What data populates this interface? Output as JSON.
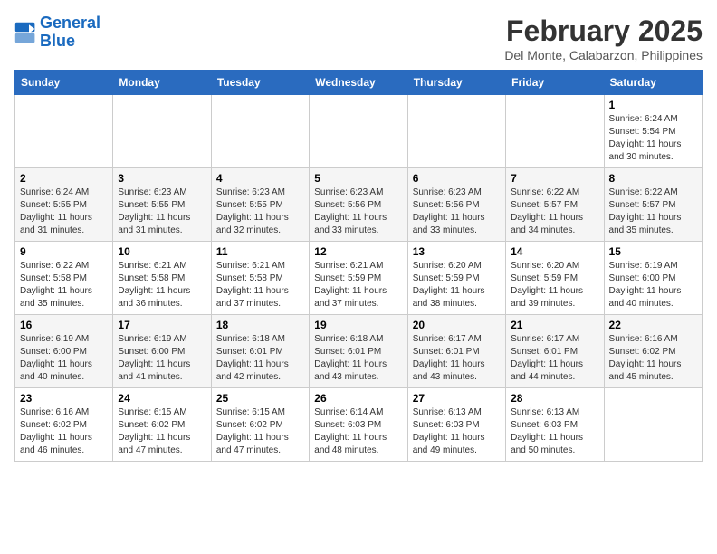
{
  "header": {
    "logo_line1": "General",
    "logo_line2": "Blue",
    "title": "February 2025",
    "subtitle": "Del Monte, Calabarzon, Philippines"
  },
  "days_of_week": [
    "Sunday",
    "Monday",
    "Tuesday",
    "Wednesday",
    "Thursday",
    "Friday",
    "Saturday"
  ],
  "weeks": [
    [
      {
        "day": "",
        "info": ""
      },
      {
        "day": "",
        "info": ""
      },
      {
        "day": "",
        "info": ""
      },
      {
        "day": "",
        "info": ""
      },
      {
        "day": "",
        "info": ""
      },
      {
        "day": "",
        "info": ""
      },
      {
        "day": "1",
        "info": "Sunrise: 6:24 AM\nSunset: 5:54 PM\nDaylight: 11 hours\nand 30 minutes."
      }
    ],
    [
      {
        "day": "2",
        "info": "Sunrise: 6:24 AM\nSunset: 5:55 PM\nDaylight: 11 hours\nand 31 minutes."
      },
      {
        "day": "3",
        "info": "Sunrise: 6:23 AM\nSunset: 5:55 PM\nDaylight: 11 hours\nand 31 minutes."
      },
      {
        "day": "4",
        "info": "Sunrise: 6:23 AM\nSunset: 5:55 PM\nDaylight: 11 hours\nand 32 minutes."
      },
      {
        "day": "5",
        "info": "Sunrise: 6:23 AM\nSunset: 5:56 PM\nDaylight: 11 hours\nand 33 minutes."
      },
      {
        "day": "6",
        "info": "Sunrise: 6:23 AM\nSunset: 5:56 PM\nDaylight: 11 hours\nand 33 minutes."
      },
      {
        "day": "7",
        "info": "Sunrise: 6:22 AM\nSunset: 5:57 PM\nDaylight: 11 hours\nand 34 minutes."
      },
      {
        "day": "8",
        "info": "Sunrise: 6:22 AM\nSunset: 5:57 PM\nDaylight: 11 hours\nand 35 minutes."
      }
    ],
    [
      {
        "day": "9",
        "info": "Sunrise: 6:22 AM\nSunset: 5:58 PM\nDaylight: 11 hours\nand 35 minutes."
      },
      {
        "day": "10",
        "info": "Sunrise: 6:21 AM\nSunset: 5:58 PM\nDaylight: 11 hours\nand 36 minutes."
      },
      {
        "day": "11",
        "info": "Sunrise: 6:21 AM\nSunset: 5:58 PM\nDaylight: 11 hours\nand 37 minutes."
      },
      {
        "day": "12",
        "info": "Sunrise: 6:21 AM\nSunset: 5:59 PM\nDaylight: 11 hours\nand 37 minutes."
      },
      {
        "day": "13",
        "info": "Sunrise: 6:20 AM\nSunset: 5:59 PM\nDaylight: 11 hours\nand 38 minutes."
      },
      {
        "day": "14",
        "info": "Sunrise: 6:20 AM\nSunset: 5:59 PM\nDaylight: 11 hours\nand 39 minutes."
      },
      {
        "day": "15",
        "info": "Sunrise: 6:19 AM\nSunset: 6:00 PM\nDaylight: 11 hours\nand 40 minutes."
      }
    ],
    [
      {
        "day": "16",
        "info": "Sunrise: 6:19 AM\nSunset: 6:00 PM\nDaylight: 11 hours\nand 40 minutes."
      },
      {
        "day": "17",
        "info": "Sunrise: 6:19 AM\nSunset: 6:00 PM\nDaylight: 11 hours\nand 41 minutes."
      },
      {
        "day": "18",
        "info": "Sunrise: 6:18 AM\nSunset: 6:01 PM\nDaylight: 11 hours\nand 42 minutes."
      },
      {
        "day": "19",
        "info": "Sunrise: 6:18 AM\nSunset: 6:01 PM\nDaylight: 11 hours\nand 43 minutes."
      },
      {
        "day": "20",
        "info": "Sunrise: 6:17 AM\nSunset: 6:01 PM\nDaylight: 11 hours\nand 43 minutes."
      },
      {
        "day": "21",
        "info": "Sunrise: 6:17 AM\nSunset: 6:01 PM\nDaylight: 11 hours\nand 44 minutes."
      },
      {
        "day": "22",
        "info": "Sunrise: 6:16 AM\nSunset: 6:02 PM\nDaylight: 11 hours\nand 45 minutes."
      }
    ],
    [
      {
        "day": "23",
        "info": "Sunrise: 6:16 AM\nSunset: 6:02 PM\nDaylight: 11 hours\nand 46 minutes."
      },
      {
        "day": "24",
        "info": "Sunrise: 6:15 AM\nSunset: 6:02 PM\nDaylight: 11 hours\nand 47 minutes."
      },
      {
        "day": "25",
        "info": "Sunrise: 6:15 AM\nSunset: 6:02 PM\nDaylight: 11 hours\nand 47 minutes."
      },
      {
        "day": "26",
        "info": "Sunrise: 6:14 AM\nSunset: 6:03 PM\nDaylight: 11 hours\nand 48 minutes."
      },
      {
        "day": "27",
        "info": "Sunrise: 6:13 AM\nSunset: 6:03 PM\nDaylight: 11 hours\nand 49 minutes."
      },
      {
        "day": "28",
        "info": "Sunrise: 6:13 AM\nSunset: 6:03 PM\nDaylight: 11 hours\nand 50 minutes."
      },
      {
        "day": "",
        "info": ""
      }
    ]
  ]
}
